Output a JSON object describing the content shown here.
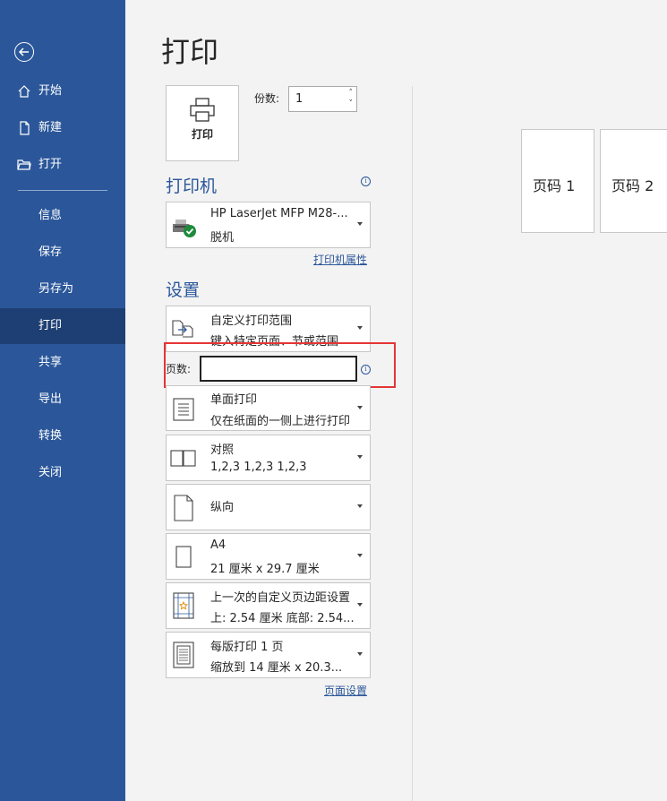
{
  "sidebar": {
    "items": [
      {
        "label": "开始",
        "icon": "home-icon"
      },
      {
        "label": "新建",
        "icon": "new-document-icon"
      },
      {
        "label": "打开",
        "icon": "open-folder-icon"
      },
      {
        "label": "信息"
      },
      {
        "label": "保存"
      },
      {
        "label": "另存为"
      },
      {
        "label": "打印",
        "active": true
      },
      {
        "label": "共享"
      },
      {
        "label": "导出"
      },
      {
        "label": "转换"
      },
      {
        "label": "关闭"
      }
    ]
  },
  "main": {
    "title": "打印",
    "print_button": "打印",
    "copies_label": "份数:",
    "copies_value": "1",
    "printer_heading": "打印机",
    "printer": {
      "name": "HP LaserJet MFP M28-...",
      "status": "脱机"
    },
    "printer_properties": "打印机属性",
    "settings_heading": "设置",
    "range": {
      "line1": "自定义打印范围",
      "line2": "键入特定页面、节或范围"
    },
    "pages_label": "页数:",
    "pages_value": "",
    "sides": {
      "line1": "单面打印",
      "line2": "仅在纸面的一侧上进行打印"
    },
    "collate": {
      "line1": "对照",
      "line2": "1,2,3    1,2,3    1,2,3"
    },
    "orientation": {
      "line1": "纵向"
    },
    "paper": {
      "line1": "A4",
      "line2": "21 厘米 x 29.7 厘米"
    },
    "margins": {
      "line1": "上一次的自定义页边距设置",
      "line2": "上: 2.54 厘米 底部: 2.54..."
    },
    "per_sheet": {
      "line1": "每版打印 1 页",
      "line2": "缩放到 14 厘米 x 20.3..."
    },
    "page_setup": "页面设置"
  },
  "preview": {
    "pages": [
      "页码  1",
      "页码  2"
    ]
  },
  "colors": {
    "accent": "#2b579a",
    "sidebar_active": "#1e3f73",
    "highlight": "#e53535"
  }
}
